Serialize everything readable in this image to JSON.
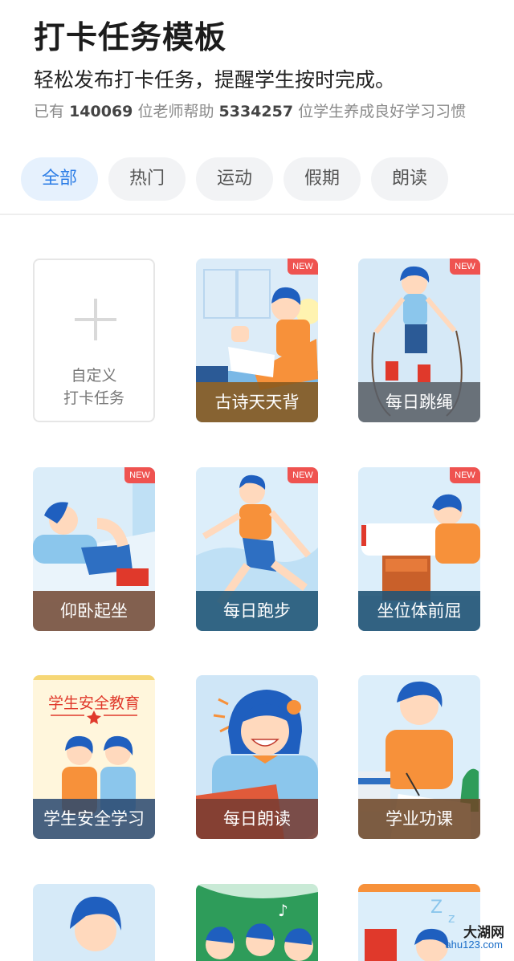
{
  "header": {
    "title": "打卡任务模板",
    "subtitle": "轻松发布打卡任务，提醒学生按时完成。",
    "stats_prefix": "已有",
    "teacher_count": "140069",
    "stats_mid": "位老师帮助",
    "student_count": "5334257",
    "stats_suffix": "位学生养成良好学习习惯"
  },
  "tabs": [
    {
      "label": "全部",
      "active": true
    },
    {
      "label": "热门",
      "active": false
    },
    {
      "label": "运动",
      "active": false
    },
    {
      "label": "假期",
      "active": false
    },
    {
      "label": "朗读",
      "active": false
    }
  ],
  "custom_card": {
    "line1": "自定义",
    "line2": "打卡任务"
  },
  "new_badge": "NEW",
  "cards": [
    {
      "label": "古诗天天背",
      "is_new": true
    },
    {
      "label": "每日跳绳",
      "is_new": true
    },
    {
      "label": "仰卧起坐",
      "is_new": true
    },
    {
      "label": "每日跑步",
      "is_new": true
    },
    {
      "label": "坐位体前屈",
      "is_new": true
    },
    {
      "label": "学生安全学习",
      "is_new": false,
      "poster_title": "学生安全教育"
    },
    {
      "label": "每日朗读",
      "is_new": false
    },
    {
      "label": "学业功课",
      "is_new": false
    }
  ],
  "watermark": {
    "text": "大湖网",
    "sub": "ahu123.com"
  },
  "colors": {
    "accent": "#2e7ee6",
    "badge": "#ef5350",
    "orange": "#f7913a",
    "blue_hair": "#1f5fbf"
  }
}
